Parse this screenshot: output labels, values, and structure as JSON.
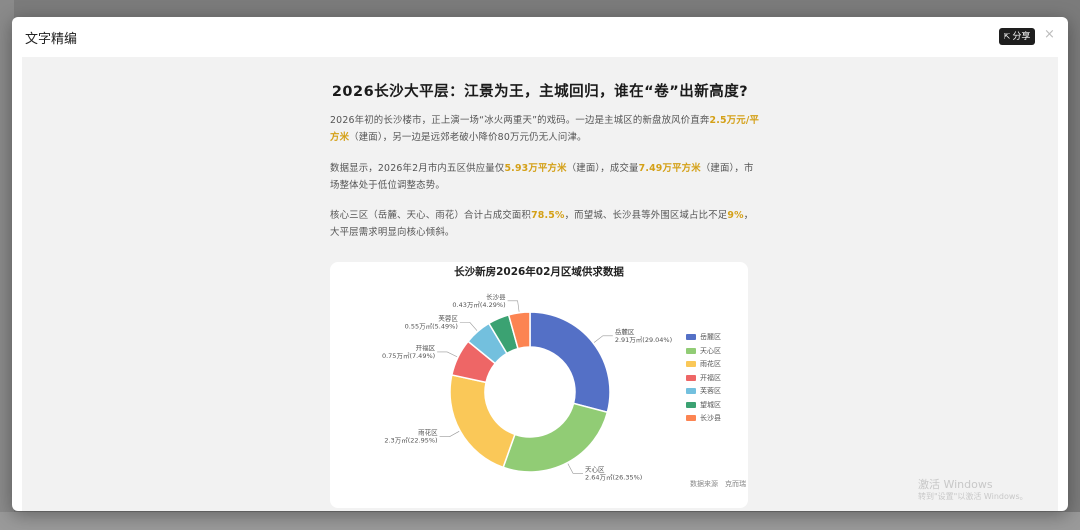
{
  "window": {
    "title": "文字精编",
    "share_label": "分享",
    "close_label": "×"
  },
  "article": {
    "title": "2026长沙大平层：江景为王，主城回归，谁在“卷”出新高度?",
    "p1": {
      "t1": "2026年初的长沙楼市，正上演一场“冰火两重天”的戏码。一边是主城区的新盘放风价直奔",
      "h1": "2.5万元/平方米",
      "t2": "（建面），另一边是远郊老破小降价80万元仍无人问津。"
    },
    "p2": {
      "t1": "数据显示，2026年2月市内五区供应量仅",
      "h1": "5.93万平方米",
      "t2": "（建面），成交量",
      "h2": "7.49万平方米",
      "t3": "（建面），市场整体处于低位调整态势。"
    },
    "p3": {
      "t1": "核心三区（岳麓、天心、雨花）合计占成交面积",
      "h1": "78.5%",
      "t2": "，而望城、长沙县等外围区域占比不足",
      "h2": "9%",
      "t3": "，大平层需求明显向核心倾斜。"
    }
  },
  "chart_data": {
    "type": "pie",
    "title": "长沙新房2026年02月区域供求数据",
    "unit": "万㎡",
    "categories": [
      "岳麓区",
      "天心区",
      "雨花区",
      "开福区",
      "芙蓉区",
      "望城区",
      "长沙县"
    ],
    "values": [
      2.91,
      2.64,
      2.3,
      0.75,
      0.55,
      0.43,
      0.43
    ],
    "shown_labels": [
      {
        "name": "岳麓区",
        "value_text": "2.91万㎡(29.04%)"
      },
      {
        "name": "天心区",
        "value_text": "2.64万㎡(26.35%)"
      },
      {
        "name": "雨花区",
        "value_text": "2.3万㎡(22.95%)"
      },
      {
        "name": "开福区",
        "value_text": "0.75万㎡(7.49%)"
      },
      {
        "name": "芙蓉区",
        "value_text": "0.55万㎡(5.49%)"
      },
      {
        "name": "望城区",
        "value_text": ""
      },
      {
        "name": "长沙县",
        "value_text": "0.43万㎡(4.29%)"
      }
    ],
    "colors": [
      "#5470c6",
      "#91cc75",
      "#fac858",
      "#ee6666",
      "#73c0de",
      "#3ba272",
      "#fc8452"
    ],
    "donut": true,
    "legend_position": "right"
  },
  "chart_footer": {
    "source": "数据来源",
    "brand": "克而瑞"
  },
  "watermark": {
    "line1": "激活 Windows",
    "line2": "转到\"设置\"以激活 Windows。"
  }
}
